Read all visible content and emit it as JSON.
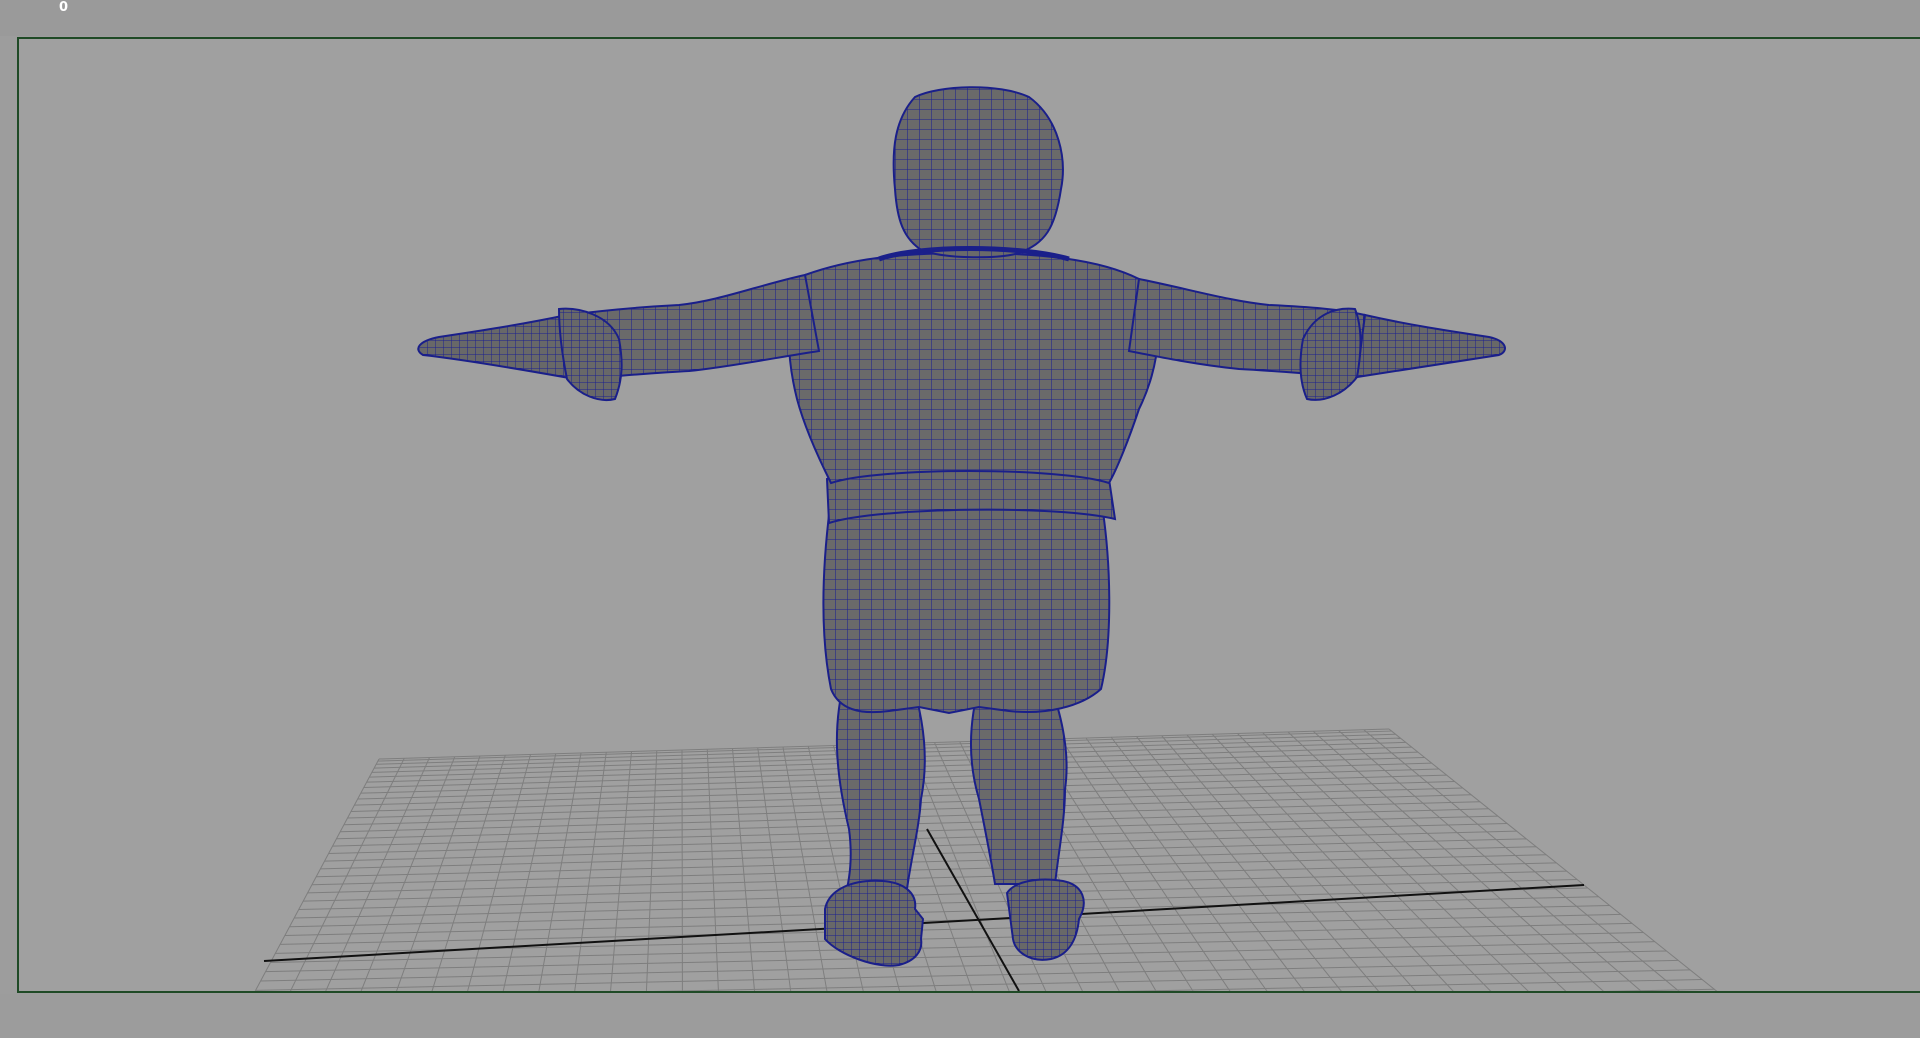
{
  "viewport": {
    "frame_counter": "0",
    "grid_icon": "ground-grid",
    "model_icon": "wireframe-character",
    "colors": {
      "background": "#a0a0a0",
      "border": "#1f4a26",
      "mesh_fill": "#6b6b6b",
      "wireframe": "#1a1f8a",
      "grid_line": "#7e7e7e",
      "axis_line": "#111111"
    }
  }
}
